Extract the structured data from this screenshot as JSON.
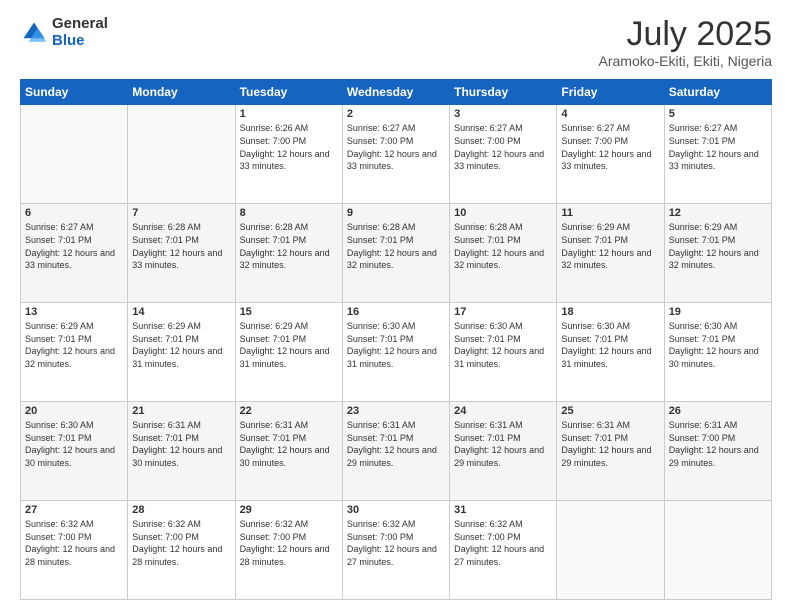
{
  "logo": {
    "general": "General",
    "blue": "Blue"
  },
  "title": "July 2025",
  "location": "Aramoko-Ekiti, Ekiti, Nigeria",
  "weekdays": [
    "Sunday",
    "Monday",
    "Tuesday",
    "Wednesday",
    "Thursday",
    "Friday",
    "Saturday"
  ],
  "weeks": [
    [
      {
        "day": null
      },
      {
        "day": null
      },
      {
        "day": 1,
        "sunrise": "6:26 AM",
        "sunset": "7:00 PM",
        "daylight": "12 hours and 33 minutes."
      },
      {
        "day": 2,
        "sunrise": "6:27 AM",
        "sunset": "7:00 PM",
        "daylight": "12 hours and 33 minutes."
      },
      {
        "day": 3,
        "sunrise": "6:27 AM",
        "sunset": "7:00 PM",
        "daylight": "12 hours and 33 minutes."
      },
      {
        "day": 4,
        "sunrise": "6:27 AM",
        "sunset": "7:00 PM",
        "daylight": "12 hours and 33 minutes."
      },
      {
        "day": 5,
        "sunrise": "6:27 AM",
        "sunset": "7:01 PM",
        "daylight": "12 hours and 33 minutes."
      }
    ],
    [
      {
        "day": 6,
        "sunrise": "6:27 AM",
        "sunset": "7:01 PM",
        "daylight": "12 hours and 33 minutes."
      },
      {
        "day": 7,
        "sunrise": "6:28 AM",
        "sunset": "7:01 PM",
        "daylight": "12 hours and 33 minutes."
      },
      {
        "day": 8,
        "sunrise": "6:28 AM",
        "sunset": "7:01 PM",
        "daylight": "12 hours and 32 minutes."
      },
      {
        "day": 9,
        "sunrise": "6:28 AM",
        "sunset": "7:01 PM",
        "daylight": "12 hours and 32 minutes."
      },
      {
        "day": 10,
        "sunrise": "6:28 AM",
        "sunset": "7:01 PM",
        "daylight": "12 hours and 32 minutes."
      },
      {
        "day": 11,
        "sunrise": "6:29 AM",
        "sunset": "7:01 PM",
        "daylight": "12 hours and 32 minutes."
      },
      {
        "day": 12,
        "sunrise": "6:29 AM",
        "sunset": "7:01 PM",
        "daylight": "12 hours and 32 minutes."
      }
    ],
    [
      {
        "day": 13,
        "sunrise": "6:29 AM",
        "sunset": "7:01 PM",
        "daylight": "12 hours and 32 minutes."
      },
      {
        "day": 14,
        "sunrise": "6:29 AM",
        "sunset": "7:01 PM",
        "daylight": "12 hours and 31 minutes."
      },
      {
        "day": 15,
        "sunrise": "6:29 AM",
        "sunset": "7:01 PM",
        "daylight": "12 hours and 31 minutes."
      },
      {
        "day": 16,
        "sunrise": "6:30 AM",
        "sunset": "7:01 PM",
        "daylight": "12 hours and 31 minutes."
      },
      {
        "day": 17,
        "sunrise": "6:30 AM",
        "sunset": "7:01 PM",
        "daylight": "12 hours and 31 minutes."
      },
      {
        "day": 18,
        "sunrise": "6:30 AM",
        "sunset": "7:01 PM",
        "daylight": "12 hours and 31 minutes."
      },
      {
        "day": 19,
        "sunrise": "6:30 AM",
        "sunset": "7:01 PM",
        "daylight": "12 hours and 30 minutes."
      }
    ],
    [
      {
        "day": 20,
        "sunrise": "6:30 AM",
        "sunset": "7:01 PM",
        "daylight": "12 hours and 30 minutes."
      },
      {
        "day": 21,
        "sunrise": "6:31 AM",
        "sunset": "7:01 PM",
        "daylight": "12 hours and 30 minutes."
      },
      {
        "day": 22,
        "sunrise": "6:31 AM",
        "sunset": "7:01 PM",
        "daylight": "12 hours and 30 minutes."
      },
      {
        "day": 23,
        "sunrise": "6:31 AM",
        "sunset": "7:01 PM",
        "daylight": "12 hours and 29 minutes."
      },
      {
        "day": 24,
        "sunrise": "6:31 AM",
        "sunset": "7:01 PM",
        "daylight": "12 hours and 29 minutes."
      },
      {
        "day": 25,
        "sunrise": "6:31 AM",
        "sunset": "7:01 PM",
        "daylight": "12 hours and 29 minutes."
      },
      {
        "day": 26,
        "sunrise": "6:31 AM",
        "sunset": "7:00 PM",
        "daylight": "12 hours and 29 minutes."
      }
    ],
    [
      {
        "day": 27,
        "sunrise": "6:32 AM",
        "sunset": "7:00 PM",
        "daylight": "12 hours and 28 minutes."
      },
      {
        "day": 28,
        "sunrise": "6:32 AM",
        "sunset": "7:00 PM",
        "daylight": "12 hours and 28 minutes."
      },
      {
        "day": 29,
        "sunrise": "6:32 AM",
        "sunset": "7:00 PM",
        "daylight": "12 hours and 28 minutes."
      },
      {
        "day": 30,
        "sunrise": "6:32 AM",
        "sunset": "7:00 PM",
        "daylight": "12 hours and 27 minutes."
      },
      {
        "day": 31,
        "sunrise": "6:32 AM",
        "sunset": "7:00 PM",
        "daylight": "12 hours and 27 minutes."
      },
      {
        "day": null
      },
      {
        "day": null
      }
    ]
  ],
  "labels": {
    "sunrise": "Sunrise:",
    "sunset": "Sunset:",
    "daylight": "Daylight:"
  },
  "colors": {
    "header_bg": "#1565c0",
    "header_text": "#ffffff",
    "row_even": "#f5f5f5",
    "row_odd": "#ffffff"
  }
}
